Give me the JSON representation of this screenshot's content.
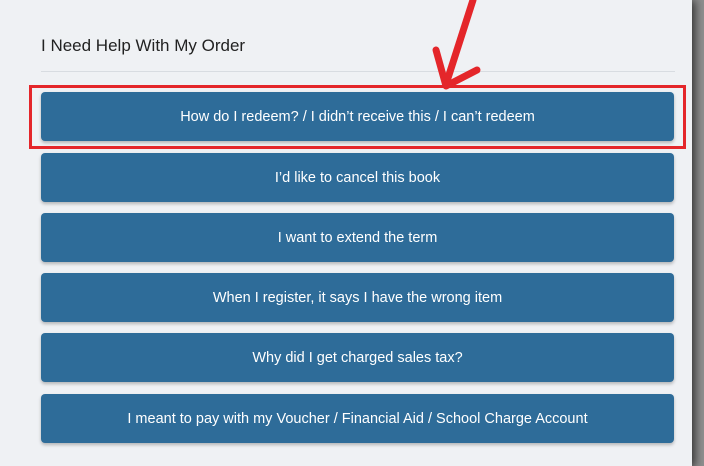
{
  "panel": {
    "title": "I Need Help With My Order"
  },
  "buttons": [
    {
      "label": "How do I redeem? / I didn’t receive this / I can’t redeem"
    },
    {
      "label": "I’d like to cancel this book"
    },
    {
      "label": "I want to extend the term"
    },
    {
      "label": "When I register, it says I have the wrong item"
    },
    {
      "label": "Why did I get charged sales tax?"
    },
    {
      "label": "I meant to pay with my Voucher / Financial Aid / School Charge Account"
    }
  ],
  "annotation": {
    "color": "#e4262a",
    "icon": "arrow-down-icon"
  },
  "colors": {
    "button_bg": "#2e6c99",
    "panel_bg": "#eff1f4"
  }
}
